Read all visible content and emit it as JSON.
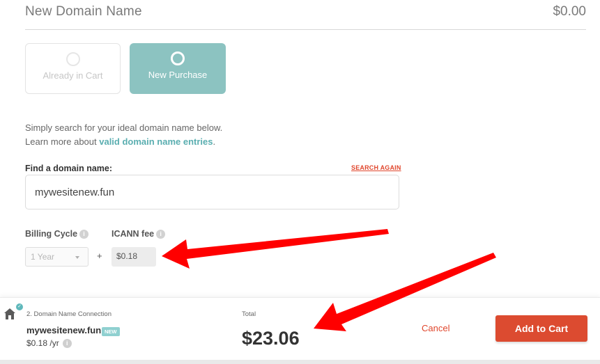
{
  "header": {
    "title": "New Domain Name",
    "price": "$0.00"
  },
  "options": [
    {
      "label": "Already in Cart",
      "selected": false
    },
    {
      "label": "New Purchase",
      "selected": true
    }
  ],
  "intro": {
    "line1": "Simply search for your ideal domain name below.",
    "line2_prefix": "Learn more about ",
    "line2_link": "valid domain name entries",
    "line2_suffix": "."
  },
  "search": {
    "label": "Find a domain name:",
    "search_again": "SEARCH AGAIN",
    "value": "mywesitenew.fun"
  },
  "billing": {
    "label": "Billing Cycle",
    "selected": "1 Year",
    "plus": "+",
    "icann_label": "ICANN fee",
    "icann_value": "$0.18",
    "info_glyph": "i"
  },
  "footer": {
    "step": "2. Domain Name Connection",
    "domain": "mywesitenew.fun",
    "badge": "NEW",
    "price": "$0.18 /yr",
    "total_label": "Total",
    "total": "$23.06",
    "cancel": "Cancel",
    "add_to_cart": "Add to Cart",
    "check_glyph": "✓"
  },
  "colors": {
    "accent_teal": "#8cc3c1",
    "link_teal": "#5aaeb0",
    "cta_red": "#dc4b30",
    "annotation_red": "#ff0000"
  }
}
